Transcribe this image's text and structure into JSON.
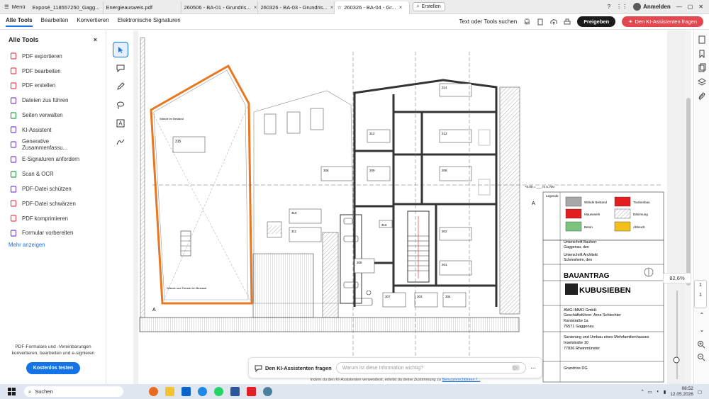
{
  "browser": {
    "menu_label": "Menü",
    "tabs": [
      {
        "label": "Exposé_118557250_Gagg...",
        "active": false
      },
      {
        "label": "Energieausweis.pdf",
        "active": false
      },
      {
        "label": "260506 - BA-01 - Grundris...",
        "active": false
      },
      {
        "label": "260326 - BA-03 - Grundris...",
        "active": false
      },
      {
        "label": "260326 - BA-04 - Gr...",
        "active": true
      }
    ],
    "new_tab_label": "Erstellen",
    "signin_label": "Anmelden"
  },
  "toolbar": {
    "menu": [
      "Alle Tools",
      "Bearbeiten",
      "Konvertieren",
      "Elektronische Signaturen"
    ],
    "search_label": "Text oder Tools suchen",
    "share_label": "Freigeben",
    "ki_label": "Den KI-Assistenten fragen"
  },
  "sidebar": {
    "title": "Alle Tools",
    "close": "×",
    "items": [
      {
        "label": "PDF exportieren",
        "color": "#e34850"
      },
      {
        "label": "PDF bearbeiten",
        "color": "#e34850"
      },
      {
        "label": "PDF erstellen",
        "color": "#e34850"
      },
      {
        "label": "Dateien zus führen",
        "color": "#7a48c9"
      },
      {
        "label": "Seiten verwalten",
        "color": "#2e9c4a"
      },
      {
        "label": "KI-Assistent",
        "color": "#7a48c9"
      },
      {
        "label": "Generative Zusammenfassu...",
        "color": "#7a48c9"
      },
      {
        "label": "E-Signaturen anfordern",
        "color": "#7a48c9"
      },
      {
        "label": "Scan & OCR",
        "color": "#2e9c4a"
      },
      {
        "label": "PDF-Datei schützen",
        "color": "#7a48c9"
      },
      {
        "label": "PDF-Datei schwärzen",
        "color": "#e34850"
      },
      {
        "label": "PDF komprimieren",
        "color": "#e34850"
      },
      {
        "label": "Formular vorbereiten",
        "color": "#7a48c9"
      }
    ],
    "more_label": "Mehr anzeigen",
    "footer_text_1": "PDF-Formulare und -Vereinbarungen",
    "footer_text_2": "konvertieren, bearbeiten und e-signieren",
    "cta_label": "Kostenlos testen"
  },
  "viewer": {
    "zoom": "82,6%",
    "page_current": "1",
    "page_total": "1"
  },
  "ki_bar": {
    "title": "Den KI-Assistenten fragen",
    "placeholder": "Warum ist diese Information wichtig?",
    "note": "Indem du den KI-Assistenten verwendest, erteilst du deine Zustimmung zu",
    "note_link": "Benutzerrichtlinien f..."
  },
  "plan": {
    "room_labels": [
      "315",
      "314",
      "312",
      "313",
      "309",
      "308",
      "306",
      "310",
      "311",
      "316",
      "302",
      "301",
      "305",
      "307",
      "303",
      "304"
    ],
    "wall_text_1": "Wände im Bestand",
    "wall_text_2": "Wände und Fenster im Bestand",
    "level": "+0,00 = ___ m ü. NN",
    "legend_title": "Legende",
    "legend": [
      {
        "label": "Wände Bestand",
        "color": "#a8a8a8"
      },
      {
        "label": "Trockenbau",
        "color": "#e41e1e"
      },
      {
        "label": "Mauerwerk",
        "color": "#e41e1e"
      },
      {
        "label": "Dämmung",
        "color": "#333333"
      },
      {
        "label": "Beton",
        "color": "#7bc47f"
      },
      {
        "label": "Abbruch",
        "color": "#f3c01b"
      }
    ],
    "sign_bauherr": "Unterschrift Bauherr",
    "sign_bauherr_place": "Gaggenau, den",
    "sign_architekt": "Unterschrift Architekt",
    "sign_architekt_place": "Schriesheim, den",
    "stamp_title": "BAUANTRAG",
    "architect_logo": "KUBUSIEBEN",
    "client_1": "AMG IMMO GmbH",
    "client_2": "Geschäftsführer: Arne Schlechter",
    "client_3": "Kantstraße 1a",
    "client_4": "76571 Gaggenau",
    "project_1": "Sanierung und Umbau eines Mehrfamilienhauses",
    "project_2": "Inselstraße 10",
    "project_3": "77836 Rheinmünster",
    "drawing": "Grundriss DG"
  },
  "taskbar": {
    "search_label": "Suchen",
    "time": "08:52",
    "date": "12.05.2026"
  }
}
